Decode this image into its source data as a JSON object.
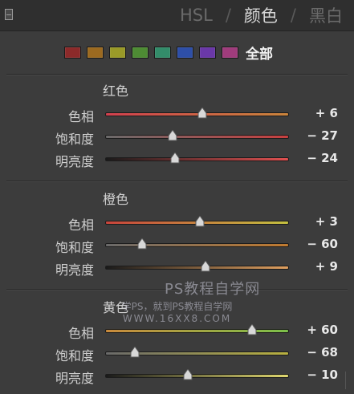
{
  "header": {
    "tabs": [
      {
        "label": "HSL",
        "active": false
      },
      {
        "label": "颜色",
        "active": true
      },
      {
        "label": "黑白",
        "active": false
      }
    ],
    "separator": "/"
  },
  "swatches": {
    "colors": [
      "#8c2a2a",
      "#9c6a20",
      "#9a9a28",
      "#4e8c34",
      "#338c6a",
      "#2e4fa8",
      "#6a38a8",
      "#a03c7c"
    ],
    "all_label": "全部"
  },
  "sections": [
    {
      "title": "红色",
      "sliders": [
        {
          "label": "色相",
          "value_text": "+ 6",
          "value": 6,
          "track_colors": [
            "#d1404e",
            "#c9843c"
          ]
        },
        {
          "label": "饱和度",
          "value_text": "− 27",
          "value": -27,
          "track_colors": [
            "#6a6a6a",
            "#c84040"
          ]
        },
        {
          "label": "明亮度",
          "value_text": "− 24",
          "value": -24,
          "track_colors": [
            "#1a1a1a",
            "#e05050"
          ]
        }
      ]
    },
    {
      "title": "橙色",
      "sliders": [
        {
          "label": "色相",
          "value_text": "+ 3",
          "value": 3,
          "track_colors": [
            "#c9443c",
            "#c4c040"
          ]
        },
        {
          "label": "饱和度",
          "value_text": "− 60",
          "value": -60,
          "track_colors": [
            "#6a6a6a",
            "#c07a30"
          ]
        },
        {
          "label": "明亮度",
          "value_text": "+ 9",
          "value": 9,
          "track_colors": [
            "#1a1a1a",
            "#e0a060"
          ]
        }
      ]
    },
    {
      "title": "黄色",
      "sliders": [
        {
          "label": "色相",
          "value_text": "+ 60",
          "value": 60,
          "track_colors": [
            "#c98a3c",
            "#7cc04a"
          ]
        },
        {
          "label": "饱和度",
          "value_text": "− 68",
          "value": -68,
          "track_colors": [
            "#6a6a6a",
            "#b8b040"
          ]
        },
        {
          "label": "明亮度",
          "value_text": "− 10",
          "value": -10,
          "track_colors": [
            "#1a1a1a",
            "#e0d870"
          ]
        }
      ]
    }
  ],
  "watermark": {
    "line1": "PS教程自学网",
    "line2": "学PS，就到PS教程自学网",
    "line3": "WWW.16XX8.COM"
  }
}
